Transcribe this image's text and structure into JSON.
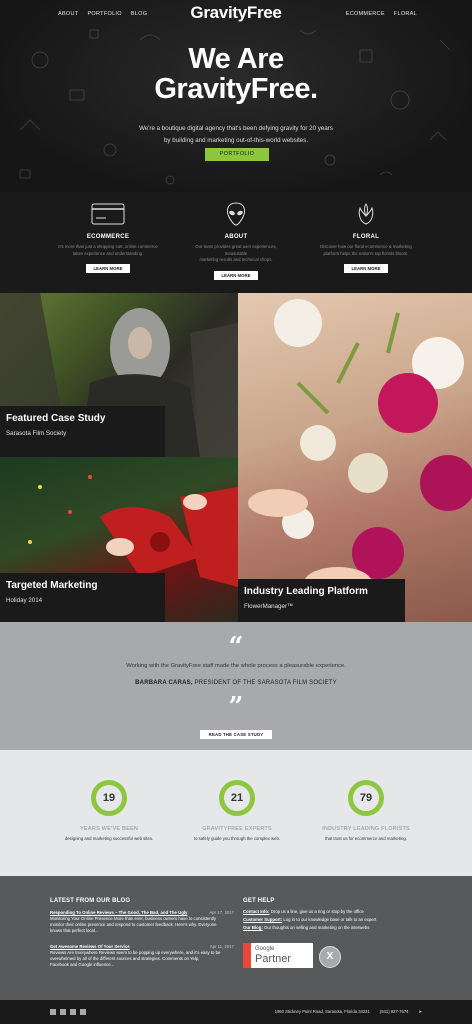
{
  "nav": {
    "left": [
      "ABOUT",
      "PORTFOLIO",
      "BLOG"
    ],
    "right": [
      "ECOMMERCE",
      "FLORAL"
    ],
    "logo": "GravityFree"
  },
  "hero": {
    "title_line1": "We Are",
    "title_line2": "GravityFree.",
    "sub_line1": "We're a boutique digital agency that's been defying gravity for 20 years",
    "sub_line2": "by building and marketing out-of-this-world websites.",
    "button": "PORTFOLIO"
  },
  "services": [
    {
      "icon": "credit-card-icon",
      "title": "ECOMMERCE",
      "desc1": "It's more than just a shopping cart, online commerce",
      "desc2": "takes experience and understanding.",
      "button": "LEARN MORE"
    },
    {
      "icon": "alien-icon",
      "title": "ABOUT",
      "desc1": "Our team provides great user experiences, measurable",
      "desc2": "marketing results and technical chops.",
      "button": "LEARN MORE"
    },
    {
      "icon": "flower-icon",
      "title": "FLORAL",
      "desc1": "Discover how our floral ecommerce & marketing",
      "desc2": "platform helps the nation's top florists bloom.",
      "button": "LEARN MORE"
    }
  ],
  "tiles": [
    {
      "title": "Featured Case Study",
      "sub": "Sarasota Film Society"
    },
    {
      "title": "Targeted Marketing",
      "sub": "Holiday 2014"
    },
    {
      "title": "Industry Leading Platform",
      "sub": "FlowerManager™"
    }
  ],
  "quote": {
    "text": "Working with the GravityFree staff made the whole process a pleasurable experience.",
    "author_name": "BARBARA CARAS,",
    "author_role": "PRESIDENT OF THE SARASOTA FILM SOCIETY",
    "button": "READ THE CASE STUDY"
  },
  "stats": [
    {
      "value": "19",
      "title": "YEARS WE'VE BEEN",
      "desc": "designing and marketing successful web sites."
    },
    {
      "value": "21",
      "title": "GRAVITYFREE EXPERTS",
      "desc": "to safely guide you through the complex web."
    },
    {
      "value": "79",
      "title": "INDUSTRY LEADING FLORISTS",
      "desc": "that trust us for ecommerce and marketing."
    }
  ],
  "blog": {
    "heading": "LATEST FROM OUR BLOG",
    "posts": [
      {
        "title": "Responding To Online Reviews – The Good, The Bad, and The Ugly",
        "date": "Apr 17, 2017",
        "l1": "Monitoring Your Online Presence More than ever, business owners have to consistently",
        "l2": "monitor their online presence and respond to customer feedback.  Here's why. Everyone",
        "l3": "knows that perfect local..."
      },
      {
        "title": "Get Awesome Reviews Of Your Service",
        "date": "Apr 11, 2017",
        "l1": "Reviews Are Everywhere Reviews seem to be popping up everywhere, and it's easy to be",
        "l2": "overwhelmed by all of the different sources and strategies. Comments on Yelp,",
        "l3": "Facebook and Google influence..."
      }
    ]
  },
  "help": {
    "heading": "GET HELP",
    "items": [
      {
        "label": "Contact Info:",
        "text": " Drop us a line, give us a ring or stop by the office"
      },
      {
        "label": "Customer Support:",
        "text": " Log in to our knowledge base or talk to an expert"
      },
      {
        "label": "Our Blog:",
        "text": " Our thoughts on selling and marketing on the interwebs"
      }
    ],
    "partner_top": "Google",
    "partner_bottom": "Partner"
  },
  "footer": {
    "address": "1960 Stickney Point Road, Sarasota, Florida 34231",
    "phone": "(941) 927-7674"
  },
  "colors": {
    "accent": "#8dc63f",
    "dark": "#1a1a1a",
    "gray": "#a7a9ac"
  }
}
